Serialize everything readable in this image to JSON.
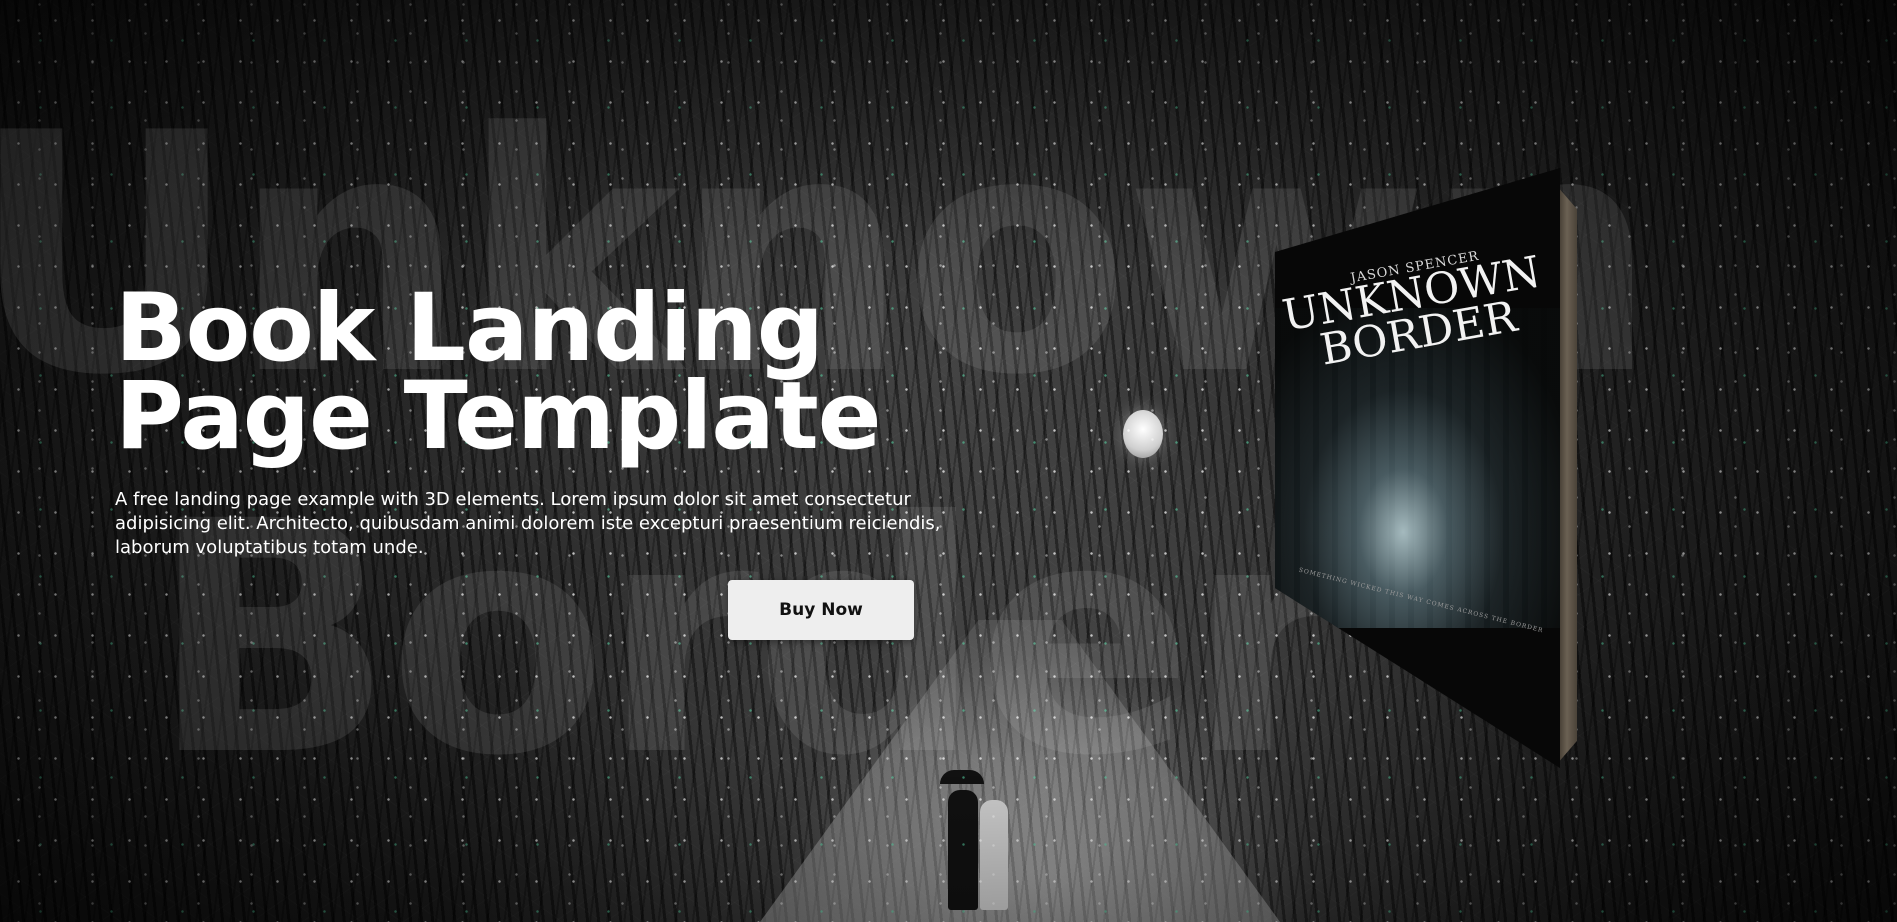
{
  "background": {
    "word_line_1": "Unknown",
    "word_line_2": "Border"
  },
  "hero": {
    "title_line_1": "Book Landing",
    "title_line_2": "Page Template",
    "description": "A free landing page example with 3D elements. Lorem ipsum dolor sit amet consectetur adipisicing elit. Architecto, quibusdam animi dolorem iste excepturi praesentium reiciendis, laborum voluptatibus totam unde.",
    "buy_button_label": "Buy Now"
  },
  "book": {
    "author": "JASON SPENCER",
    "title_line_1": "UNKNOWN",
    "title_line_2": "BORDER",
    "tagline": "SOMETHING WICKED THIS WAY COMES ACROSS THE BORDER"
  },
  "colors": {
    "button_background": "#eeeeee",
    "button_text": "#111111",
    "page_background": "#0b0b0b"
  }
}
